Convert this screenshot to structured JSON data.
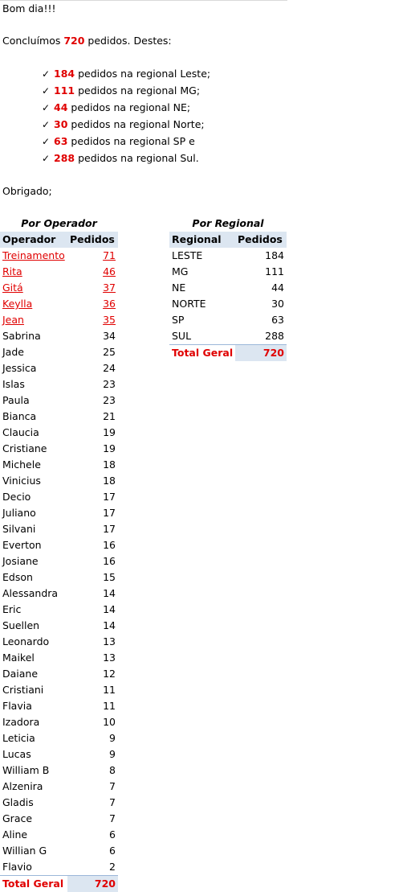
{
  "greeting": "Bom dia!!!",
  "summary": {
    "prefix": "Concluímos ",
    "total": "720",
    "suffix": " pedidos. Destes:"
  },
  "regional_list": [
    {
      "count": "184",
      "text": " pedidos na regional Leste;"
    },
    {
      "count": "111",
      "text": " pedidos na regional MG;"
    },
    {
      "count": "44",
      "text": " pedidos na regional NE;"
    },
    {
      "count": "30",
      "text": " pedidos na regional Norte;"
    },
    {
      "count": "63",
      "text": " pedidos na regional SP e"
    },
    {
      "count": "288",
      "text": " pedidos na regional Sul."
    }
  ],
  "check_symbol": "✓",
  "signoff": "Obrigado;",
  "operator_table": {
    "title": "Por Operador",
    "headers": [
      "Operador",
      "Pedidos"
    ],
    "rows": [
      {
        "name": "Treinamento",
        "value": "71",
        "highlight": true
      },
      {
        "name": "Rita",
        "value": "46",
        "highlight": true
      },
      {
        "name": "Gitá",
        "value": "37",
        "highlight": true
      },
      {
        "name": "Keylla",
        "value": "36",
        "highlight": true
      },
      {
        "name": "Jean",
        "value": "35",
        "highlight": true
      },
      {
        "name": "Sabrina",
        "value": "34"
      },
      {
        "name": "Jade",
        "value": "25"
      },
      {
        "name": "Jessica",
        "value": "24"
      },
      {
        "name": "Islas",
        "value": "23"
      },
      {
        "name": "Paula",
        "value": "23"
      },
      {
        "name": "Bianca",
        "value": "21"
      },
      {
        "name": "Claucia",
        "value": "19"
      },
      {
        "name": "Cristiane",
        "value": "19"
      },
      {
        "name": "Michele",
        "value": "18"
      },
      {
        "name": "Vinicius",
        "value": "18"
      },
      {
        "name": "Decio",
        "value": "17"
      },
      {
        "name": "Juliano",
        "value": "17"
      },
      {
        "name": "Silvani",
        "value": "17"
      },
      {
        "name": "Everton",
        "value": "16"
      },
      {
        "name": "Josiane",
        "value": "16"
      },
      {
        "name": "Edson",
        "value": "15"
      },
      {
        "name": "Alessandra",
        "value": "14"
      },
      {
        "name": "Eric",
        "value": "14"
      },
      {
        "name": "Suellen",
        "value": "14"
      },
      {
        "name": "Leonardo",
        "value": "13"
      },
      {
        "name": "Maikel",
        "value": "13"
      },
      {
        "name": "Daiane",
        "value": "12"
      },
      {
        "name": "Cristiani",
        "value": "11"
      },
      {
        "name": "Flavia",
        "value": "11"
      },
      {
        "name": "Izadora",
        "value": "10"
      },
      {
        "name": "Leticia",
        "value": "9"
      },
      {
        "name": "Lucas",
        "value": "9"
      },
      {
        "name": "William B",
        "value": "8"
      },
      {
        "name": "Alzenira",
        "value": "7"
      },
      {
        "name": "Gladis",
        "value": "7"
      },
      {
        "name": "Grace",
        "value": "7"
      },
      {
        "name": "Aline",
        "value": "6"
      },
      {
        "name": "Willian G",
        "value": "6"
      },
      {
        "name": "Flavio",
        "value": "2"
      }
    ],
    "total_label": "Total Geral",
    "total_value": "720"
  },
  "regional_table": {
    "title": "Por Regional",
    "headers": [
      "Regional",
      "Pedidos"
    ],
    "rows": [
      {
        "name": "LESTE",
        "value": "184"
      },
      {
        "name": "MG",
        "value": "111"
      },
      {
        "name": "NE",
        "value": "44"
      },
      {
        "name": "NORTE",
        "value": "30"
      },
      {
        "name": "SP",
        "value": "63"
      },
      {
        "name": "SUL",
        "value": "288"
      }
    ],
    "total_label": "Total Geral",
    "total_value": "720"
  },
  "colors": {
    "highlight_red": "#e00000",
    "header_fill": "#dce6f1"
  }
}
